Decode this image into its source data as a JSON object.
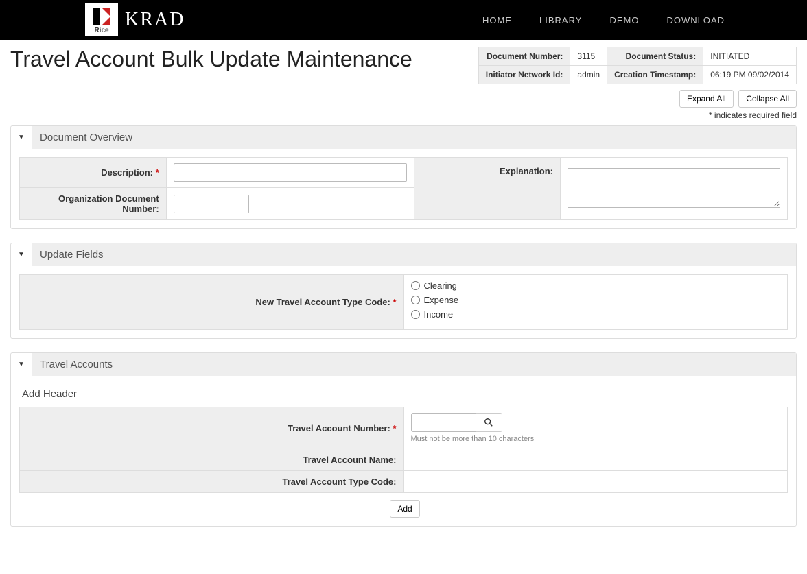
{
  "topbar": {
    "logo_label": "Rice",
    "brand": "KRAD",
    "nav": {
      "home": "HOME",
      "library": "LIBRARY",
      "demo": "DEMO",
      "download": "DOWNLOAD"
    }
  },
  "page_title": "Travel Account Bulk Update Maintenance",
  "doc_info": {
    "doc_number_label": "Document Number:",
    "doc_number_value": "3115",
    "doc_status_label": "Document Status:",
    "doc_status_value": "INITIATED",
    "initiator_label": "Initiator Network Id:",
    "initiator_value": "admin",
    "timestamp_label": "Creation Timestamp:",
    "timestamp_value": "06:19 PM 09/02/2014"
  },
  "controls": {
    "expand": "Expand All",
    "collapse": "Collapse All",
    "required_note": "* indicates required field"
  },
  "sections": {
    "doc_overview": {
      "title": "Document Overview",
      "description_label": "Description:",
      "description_value": "",
      "org_doc_label": "Organization Document Number:",
      "org_doc_value": "",
      "explanation_label": "Explanation:",
      "explanation_value": ""
    },
    "update_fields": {
      "title": "Update Fields",
      "type_code_label": "New Travel Account Type Code:",
      "options": [
        "Clearing",
        "Expense",
        "Income"
      ]
    },
    "travel_accounts": {
      "title": "Travel Accounts",
      "subheader": "Add Header",
      "account_number_label": "Travel Account Number:",
      "account_number_value": "",
      "account_number_hint": "Must not be more than 10 characters",
      "account_name_label": "Travel Account Name:",
      "account_name_value": "",
      "account_type_label": "Travel Account Type Code:",
      "account_type_value": "",
      "add_button": "Add"
    }
  }
}
